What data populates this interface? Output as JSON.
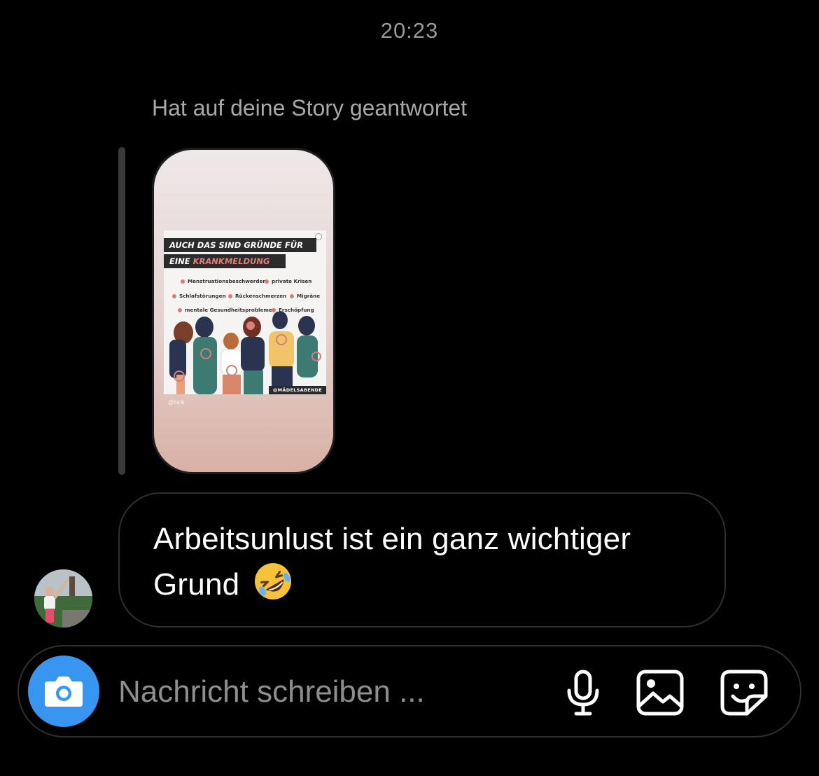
{
  "chat": {
    "timestamp": "20:23",
    "reply_label": "Hat auf deine Story geantwortet",
    "story": {
      "title_line1": "AUCH DAS SIND GRÜNDE FÜR",
      "title_line2_prefix": "EINE ",
      "title_line2_highlight": "KRANKMELDUNG",
      "tags": [
        "Menstruationsbeschwerden",
        "private Krisen",
        "Schlafstörungen",
        "Rückenschmerzen",
        "Migräne",
        "mentale Gesundheitsprobleme",
        "Erschöpfung"
      ],
      "brand": "@MÄDELSABENDE",
      "credit": "@funk"
    },
    "message": {
      "text": "Arbeitsunlust ist ein ganz wichtiger Grund",
      "emoji": "rolling-on-the-floor-laughing-emoji"
    }
  },
  "composer": {
    "placeholder": "Nachricht schreiben ...",
    "icons": [
      "camera-icon",
      "microphone-icon",
      "gallery-icon",
      "sticker-icon"
    ]
  },
  "colors": {
    "background": "#000000",
    "accent": "#3896f0",
    "muted_text": "#a8a8a8",
    "highlight": "#e07f7a"
  }
}
